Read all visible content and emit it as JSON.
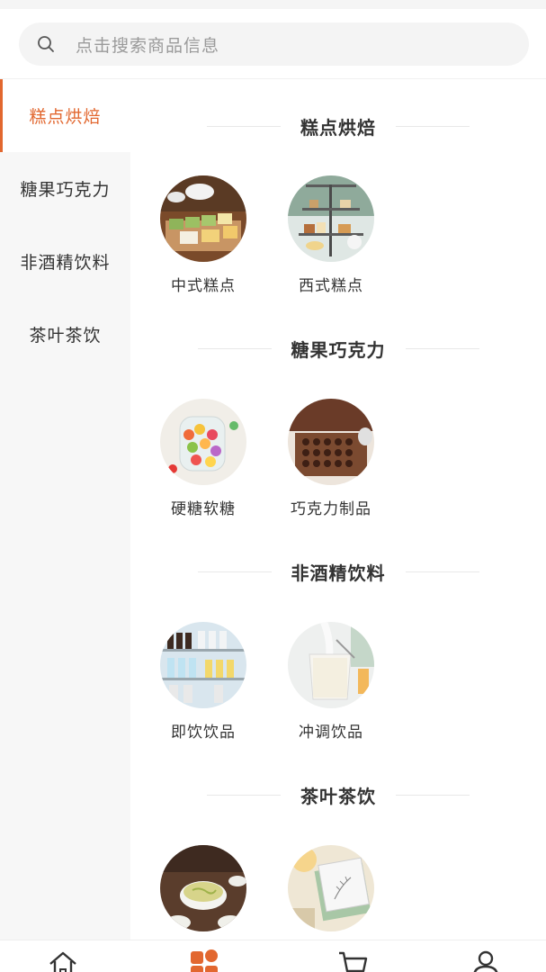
{
  "search": {
    "placeholder": "点击搜索商品信息"
  },
  "sidebar": {
    "items": [
      {
        "label": "糕点烘焙",
        "active": true
      },
      {
        "label": "糖果巧克力",
        "active": false
      },
      {
        "label": "非酒精饮料",
        "active": false
      },
      {
        "label": "茶叶茶饮",
        "active": false
      }
    ]
  },
  "sections": [
    {
      "title": "糕点烘焙",
      "items": [
        {
          "label": "中式糕点"
        },
        {
          "label": "西式糕点"
        }
      ]
    },
    {
      "title": "糖果巧克力",
      "items": [
        {
          "label": "硬糖软糖"
        },
        {
          "label": "巧克力制品"
        }
      ]
    },
    {
      "title": "非酒精饮料",
      "items": [
        {
          "label": "即饮饮品"
        },
        {
          "label": "冲调饮品"
        }
      ]
    },
    {
      "title": "茶叶茶饮",
      "items": [
        {
          "label": ""
        },
        {
          "label": ""
        }
      ]
    }
  ],
  "tabbar": {
    "tabs": [
      {
        "icon": "home-icon",
        "active": false
      },
      {
        "icon": "category-icon",
        "active": true
      },
      {
        "icon": "cart-icon",
        "active": false
      },
      {
        "icon": "user-icon",
        "active": false
      }
    ]
  },
  "colors": {
    "accent": "#e2672f",
    "sidebar_bg": "#f7f7f7",
    "search_bg": "#f4f4f4"
  }
}
